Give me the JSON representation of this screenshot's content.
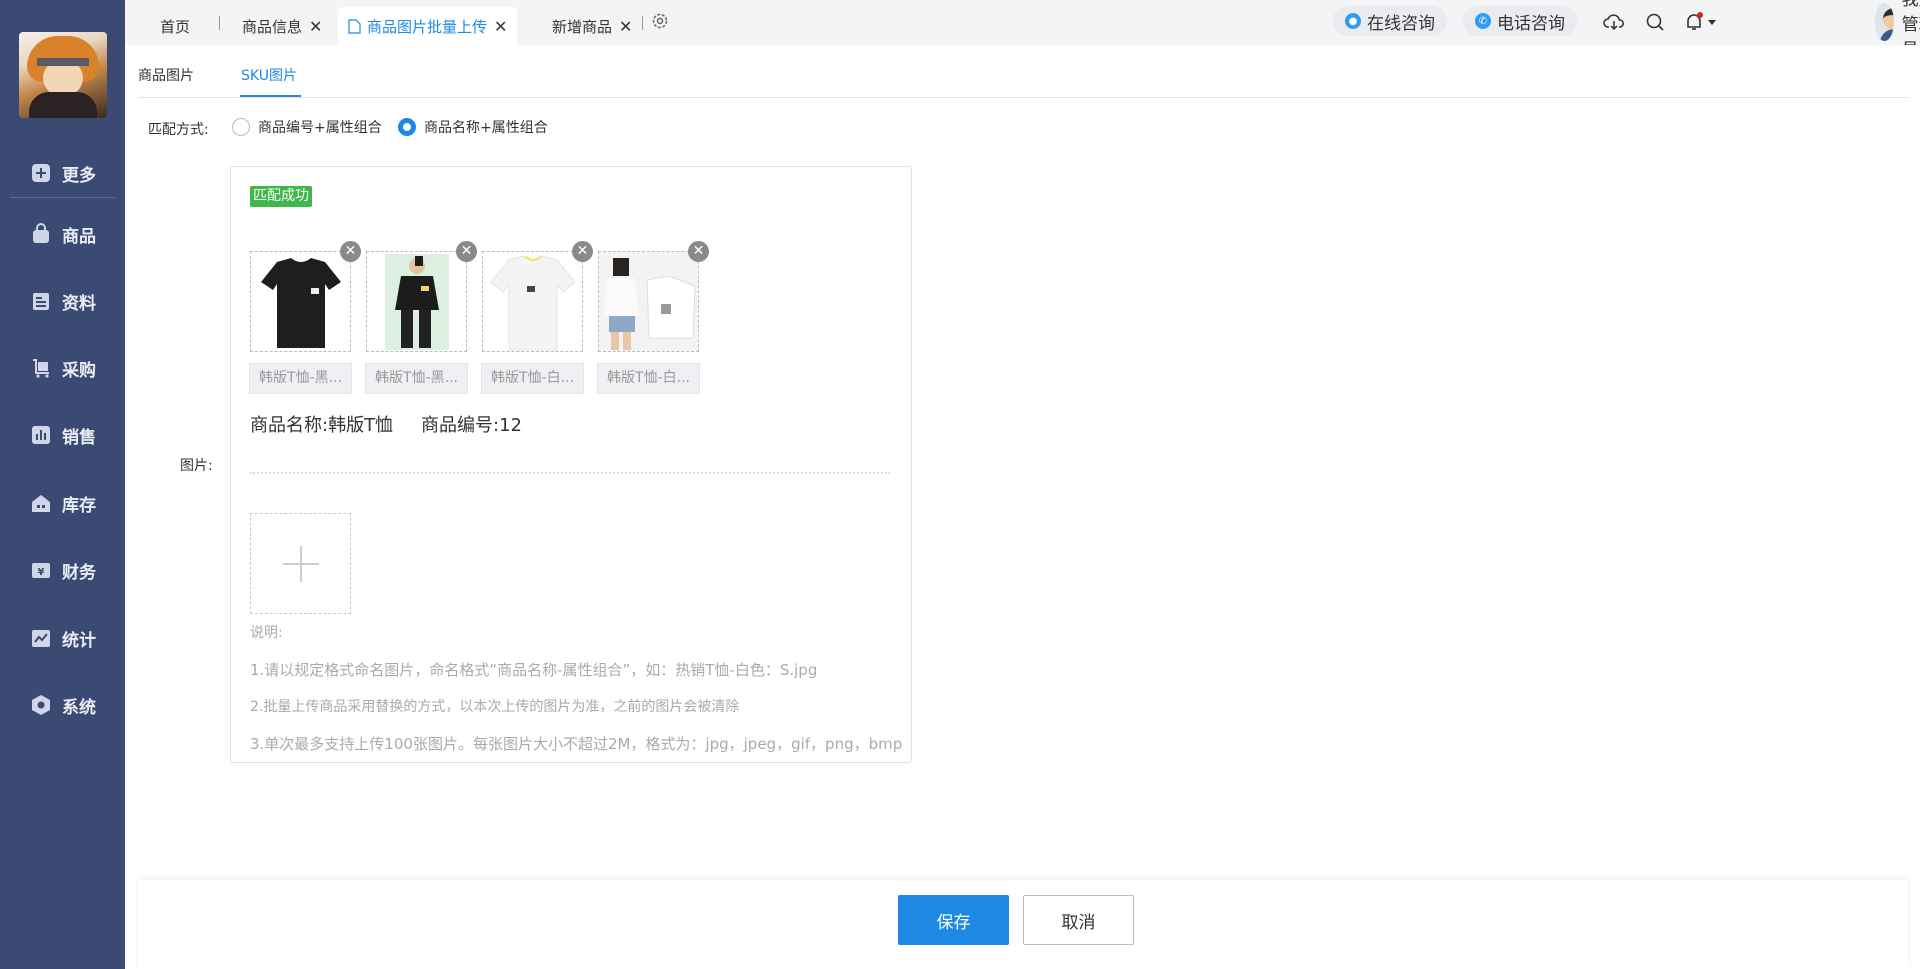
{
  "sidebar": {
    "items": [
      {
        "label": "更多",
        "icon": "plus-square-icon"
      },
      {
        "label": "商品",
        "icon": "bag-icon"
      },
      {
        "label": "资料",
        "icon": "document-icon"
      },
      {
        "label": "采购",
        "icon": "cart-icon"
      },
      {
        "label": "销售",
        "icon": "bar-chart-icon"
      },
      {
        "label": "库存",
        "icon": "warehouse-icon"
      },
      {
        "label": "财务",
        "icon": "yen-icon"
      },
      {
        "label": "统计",
        "icon": "trend-icon"
      },
      {
        "label": "系统",
        "icon": "hexagon-settings-icon"
      }
    ]
  },
  "tabs": {
    "home": "首页",
    "product_info": "商品信息",
    "batch_upload": "商品图片批量上传",
    "new_product": "新增商品",
    "close_glyph": "✕"
  },
  "header": {
    "online_consult": "在线咨询",
    "phone_consult": "电话咨询",
    "user_name": "我是管理员",
    "accent": "#1e88e5",
    "notification_dot": "#e02020"
  },
  "subtabs": {
    "product_images": "商品图片",
    "sku_images": "SKU图片"
  },
  "match": {
    "label": "匹配方式:",
    "option_code": "商品编号+属性组合",
    "option_name": "商品名称+属性组合",
    "selected": "option_name"
  },
  "panel": {
    "field_label": "图片:",
    "status": "匹配成功",
    "status_color": "#3eb84a",
    "images": [
      {
        "caption": "韩版T恤-黑...",
        "shirt_color": "#1e1e1e"
      },
      {
        "caption": "韩版T恤-黑...",
        "shirt_color": "#222222"
      },
      {
        "caption": "韩版T恤-白...",
        "shirt_color": "#f4f4f4"
      },
      {
        "caption": "韩版T恤-白...",
        "shirt_color": "#f7f7f7"
      }
    ],
    "product_name": "商品名称:韩版T恤",
    "product_code": "商品编号:12",
    "notes": {
      "title": "说明:",
      "line1": "1.请以规定格式命名图片，命名格式“商品名称-属性组合”，如：热销T恤-白色：S.jpg",
      "line2": "2.批量上传商品采用替换的方式，以本次上传的图片为准，之前的图片会被清除",
      "line3": "3.单次最多支持上传100张图片。每张图片大小不超过2M，格式为：jpg，jpeg，gif，png，bmp"
    }
  },
  "footer": {
    "save": "保存",
    "cancel": "取消"
  }
}
